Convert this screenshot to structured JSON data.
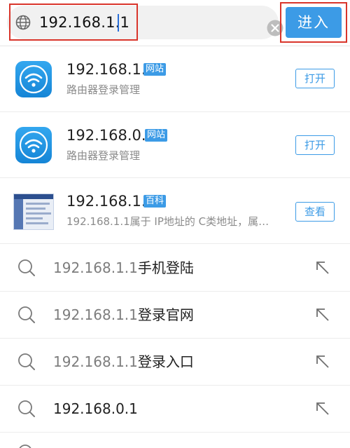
{
  "search": {
    "url_value": "192.168.1.1",
    "go_label": "进入",
    "icons": {
      "left": "globe-icon",
      "clear": "clear-circle-icon"
    },
    "highlight_color": "#d9352b",
    "accent": "#3c9be6"
  },
  "results": [
    {
      "title": "192.168.1.1",
      "tag": "网站",
      "subtitle": "路由器登录管理",
      "action": "打开",
      "icon": "wifi-app-icon"
    },
    {
      "title": "192.168.0.1",
      "tag": "网站",
      "subtitle": "路由器登录管理",
      "action": "打开",
      "icon": "wifi-app-icon"
    },
    {
      "title": "192.168.1.1",
      "tag": "百科",
      "subtitle": "192.168.1.1属于 IP地址的 C类地址，属…",
      "action": "查看",
      "icon": "router-page-thumbnail"
    }
  ],
  "suggestions": [
    {
      "query": "192.168.1.1",
      "suffix": "手机登陆"
    },
    {
      "query": "192.168.1.1",
      "suffix": "登录官网"
    },
    {
      "query": "192.168.1.1",
      "suffix": "登录入口"
    },
    {
      "query": "192.168.0.1",
      "suffix": ""
    }
  ]
}
